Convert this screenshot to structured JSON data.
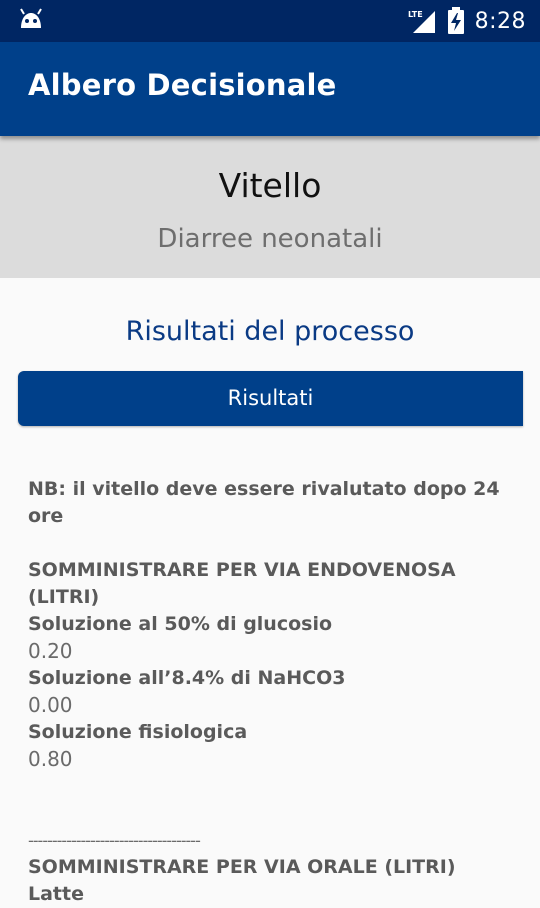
{
  "status_bar": {
    "time": "8:28",
    "network_label": "LTE"
  },
  "app_bar": {
    "title": "Albero Decisionale"
  },
  "header": {
    "animal": "Vitello",
    "disease": "Diarree neonatali"
  },
  "section": {
    "title": "Risultati del processo",
    "button_label": "Risultati"
  },
  "results": {
    "note": "NB: il vitello deve essere rivalutato dopo 24 ore",
    "iv_heading": "SOMMINISTRARE PER VIA ENDOVENOSA (LITRI)",
    "iv_items": [
      {
        "label": "Soluzione al 50% di glucosio",
        "value": "0.20"
      },
      {
        "label": "Soluzione all’8.4% di NaHCO3",
        "value": "0.00"
      },
      {
        "label": "Soluzione fisiologica",
        "value": "0.80"
      }
    ],
    "divider": "------------------------------------",
    "oral_heading": "SOMMINISTRARE PER VIA ORALE (LITRI)",
    "oral_items": [
      {
        "label": "Latte"
      }
    ]
  },
  "colors": {
    "status_bar": "#002663",
    "app_bar": "#00408a",
    "header_bg": "#dcdcdc",
    "accent_text": "#0a3a84"
  }
}
